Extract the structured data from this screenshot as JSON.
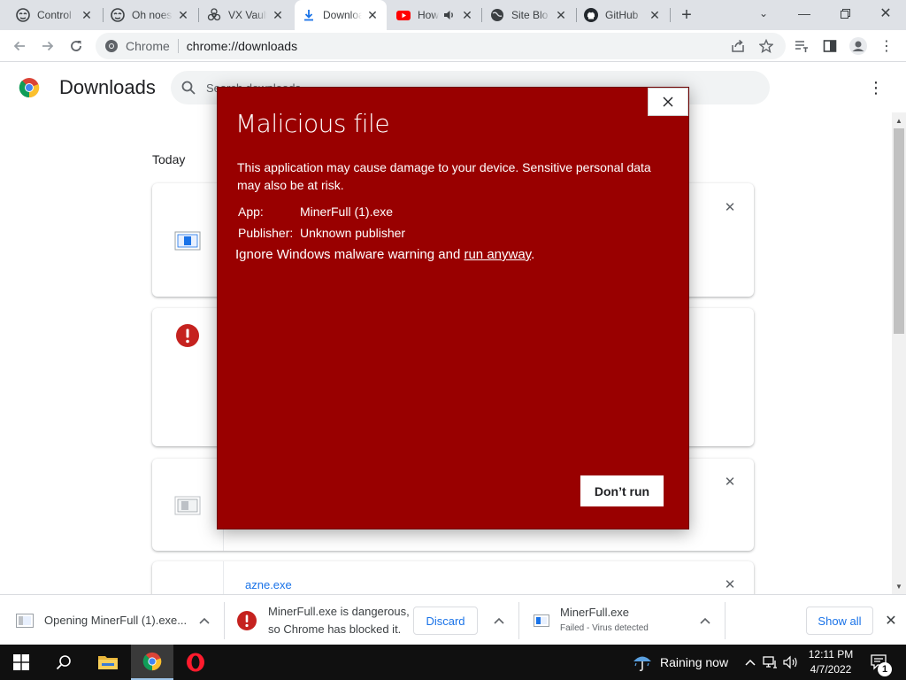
{
  "tabs": [
    {
      "title": "Control",
      "icon": "hacker-mask-icon",
      "active": false
    },
    {
      "title": "Oh noes",
      "icon": "hacker-mask-icon",
      "active": false
    },
    {
      "title": "VX Vault",
      "icon": "biohazard-icon",
      "active": false
    },
    {
      "title": "Downloads",
      "icon": "download-icon",
      "active": true
    },
    {
      "title": "How",
      "icon": "youtube-icon",
      "active": false,
      "audio": true
    },
    {
      "title": "Site Blo",
      "icon": "globe-icon",
      "active": false
    },
    {
      "title": "GitHub",
      "icon": "github-icon",
      "active": false
    }
  ],
  "toolbar": {
    "chip_label": "Chrome",
    "url": "chrome://downloads"
  },
  "downloads_page": {
    "title": "Downloads",
    "search_placeholder": "Search downloads",
    "day_label": "Today",
    "cards": [
      {
        "icon": "file-icon",
        "filename": ""
      },
      {
        "icon": "warning-icon",
        "filename": ""
      },
      {
        "icon": "file-icon-grey",
        "filename": ""
      },
      {
        "icon": "none",
        "filename": "azne.exe"
      }
    ]
  },
  "dialog": {
    "title": "Malicious file",
    "body": "This application may cause damage to your device. Sensitive personal data may also be at risk.",
    "app_label": "App:",
    "app_value": "MinerFull (1).exe",
    "publisher_label": "Publisher:",
    "publisher_value": "Unknown publisher",
    "run_prefix": "Ignore Windows malware warning and ",
    "run_link": "run anyway",
    "run_suffix": ".",
    "dont_run_label": "Don’t run",
    "background_color": "#990000"
  },
  "shelf": {
    "item1_text": "Opening MinerFull (1).exe...",
    "item2_line1": "MinerFull.exe is dangerous,",
    "item2_line2": "so Chrome has blocked it.",
    "discard_label": "Discard",
    "item3_name": "MinerFull.exe",
    "item3_status": "Failed - Virus detected",
    "show_all_label": "Show all"
  },
  "taskbar": {
    "weather_text": "Raining now",
    "time": "12:11 PM",
    "date": "4/7/2022",
    "notification_count": "1"
  },
  "colors": {
    "accent_blue": "#1a73e8",
    "danger_red": "#c5221f",
    "dialog_red": "#990000"
  }
}
